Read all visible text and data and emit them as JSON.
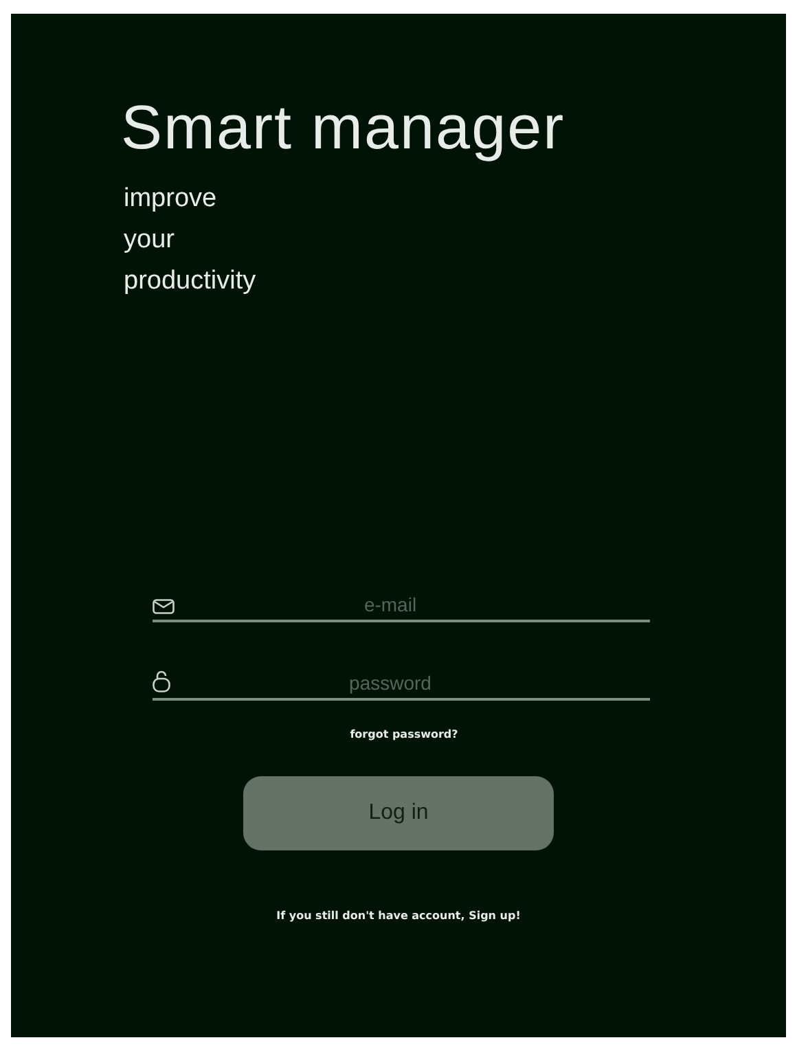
{
  "title": "Smart manager",
  "tagline": [
    "improve",
    "your",
    "productivity"
  ],
  "fields": [
    {
      "kind": "email",
      "placeholder": "e-mail"
    },
    {
      "kind": "password",
      "placeholder": "password"
    }
  ],
  "forgot_link": "forgot password?",
  "login_button": "Log in",
  "signup_text": "If you still don't have account, Sign up!"
}
